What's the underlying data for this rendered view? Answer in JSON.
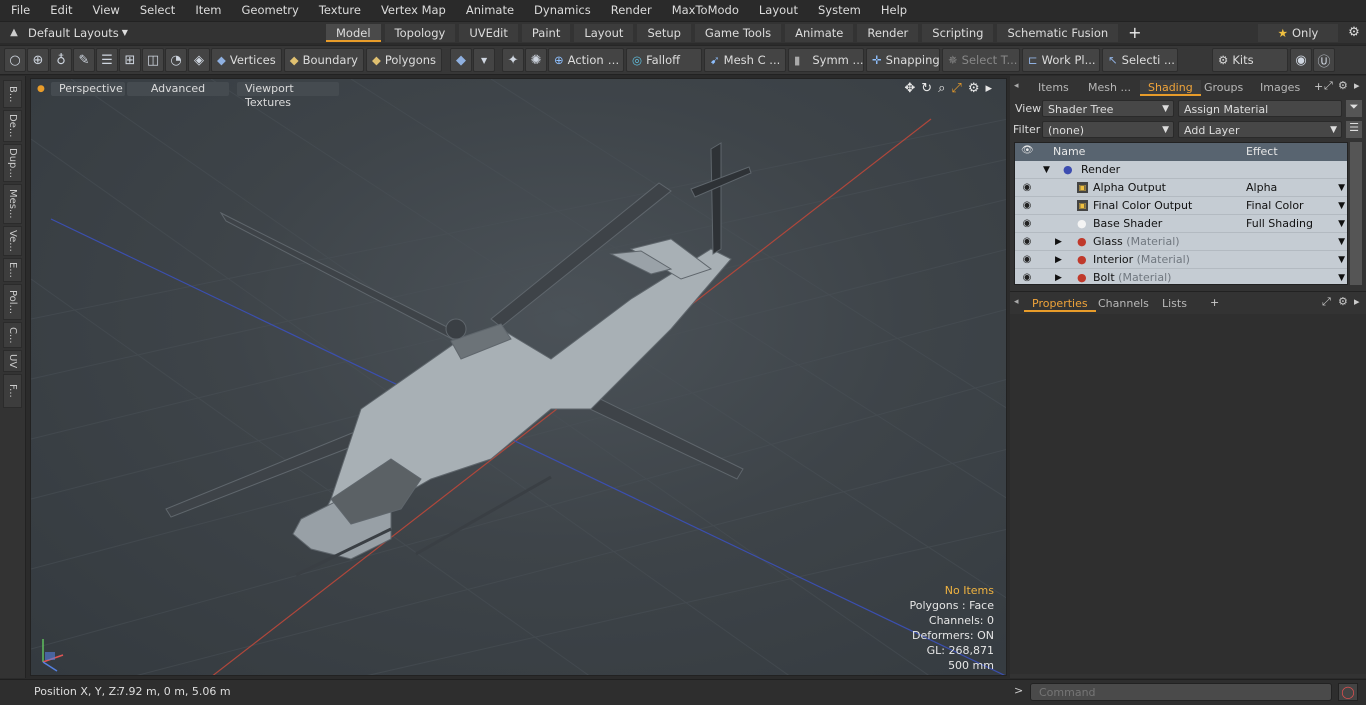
{
  "menubar": [
    "File",
    "Edit",
    "View",
    "Select",
    "Item",
    "Geometry",
    "Texture",
    "Vertex Map",
    "Animate",
    "Dynamics",
    "Render",
    "MaxToModo",
    "Layout",
    "System",
    "Help"
  ],
  "layout": {
    "selector": "Default Layouts",
    "tabs": [
      "Model",
      "Topology",
      "UVEdit",
      "Paint",
      "Layout",
      "Setup",
      "Game Tools",
      "Animate",
      "Render",
      "Scripting",
      "Schematic Fusion"
    ],
    "active_tab": "Model",
    "add_label": "+",
    "only_label": "Only"
  },
  "toolbar": {
    "vertices": "Vertices",
    "boundary": "Boundary",
    "polygons": "Polygons",
    "action": "Action",
    "falloff": "Falloff",
    "mesh": "Mesh C ...",
    "symm": "Symm ...",
    "snapping": "Snapping",
    "select_t": "Select T...",
    "work_pl": "Work Pl...",
    "selecti": "Selecti ...",
    "kits": "Kits"
  },
  "left_tabs": [
    "B...",
    "De...",
    "Dup...",
    "Mes...",
    "Ve...",
    "E...",
    "Pol...",
    "C...",
    "UV",
    "F..."
  ],
  "viewport": {
    "tabs": [
      "Perspective",
      "Advanced",
      "Viewport Textures"
    ],
    "hud": {
      "no_items": "No Items",
      "polygons": "Polygons : Face",
      "channels": "Channels: 0",
      "deformers": "Deformers: ON",
      "gl": "GL: 268,871",
      "scale": "500 mm"
    }
  },
  "right_panel": {
    "tabs": [
      "Items",
      "Mesh ...",
      "Shading",
      "Groups",
      "Images"
    ],
    "active_tab": "Shading",
    "view_label": "View",
    "view_value": "Shader Tree",
    "assign_material": "Assign Material",
    "filter_label": "Filter",
    "filter_value": "(none)",
    "add_layer": "Add Layer",
    "columns": {
      "name": "Name",
      "effect": "Effect"
    },
    "rows": [
      {
        "name": "Render",
        "effect": "",
        "tag": ""
      },
      {
        "name": "Alpha Output",
        "effect": "Alpha",
        "tag": ""
      },
      {
        "name": "Final Color Output",
        "effect": "Final Color",
        "tag": ""
      },
      {
        "name": "Base Shader",
        "effect": "Full Shading",
        "tag": ""
      },
      {
        "name": "Glass",
        "effect": "",
        "tag": "(Material)"
      },
      {
        "name": "Interior",
        "effect": "",
        "tag": "(Material)"
      },
      {
        "name": "Bolt",
        "effect": "",
        "tag": "(Material)"
      }
    ],
    "lower_tabs": [
      "Properties",
      "Channels",
      "Lists"
    ],
    "lower_active": "Properties",
    "command_placeholder": "Command"
  },
  "status": {
    "position_label": "Position X, Y, Z:",
    "position_value": "7.92 m, 0 m, 5.06 m"
  },
  "colors": {
    "accent": "#e89c2a",
    "hud_highlight": "#f0b340"
  }
}
